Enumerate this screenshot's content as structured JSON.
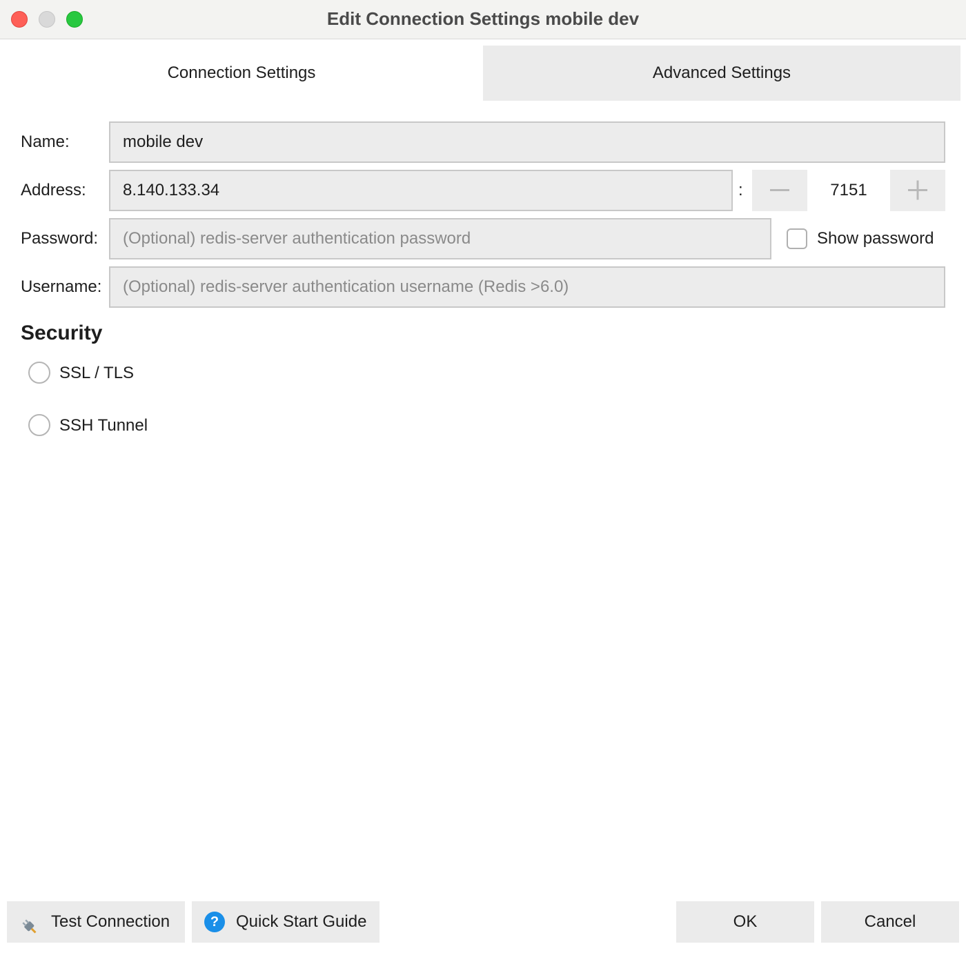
{
  "window": {
    "title": "Edit Connection Settings mobile dev"
  },
  "tabs": [
    {
      "label": "Connection Settings",
      "active": true
    },
    {
      "label": "Advanced Settings",
      "active": false
    }
  ],
  "form": {
    "name_label": "Name:",
    "name_value": "mobile dev",
    "address_label": "Address:",
    "address_value": "8.140.133.34",
    "port_separator": ":",
    "port_value": "7151",
    "password_label": "Password:",
    "password_placeholder": "(Optional) redis-server authentication password",
    "show_password_label": "Show password",
    "username_label": "Username:",
    "username_placeholder": "(Optional) redis-server authentication username (Redis >6.0)"
  },
  "security": {
    "title": "Security",
    "options": [
      {
        "label": "SSL / TLS",
        "selected": false
      },
      {
        "label": "SSH Tunnel",
        "selected": false
      }
    ]
  },
  "footer": {
    "test_connection": "Test Connection",
    "quick_start": "Quick Start Guide",
    "ok": "OK",
    "cancel": "Cancel"
  },
  "icons": {
    "test_connection": "plug-icon",
    "quick_start": "help-icon",
    "port_decrement": "minus-icon",
    "port_increment": "plus-icon"
  },
  "colors": {
    "close": "#fe5f57",
    "minimize": "#d9d9d9",
    "maximize": "#28c840",
    "help_accent": "#1a8fe8"
  }
}
